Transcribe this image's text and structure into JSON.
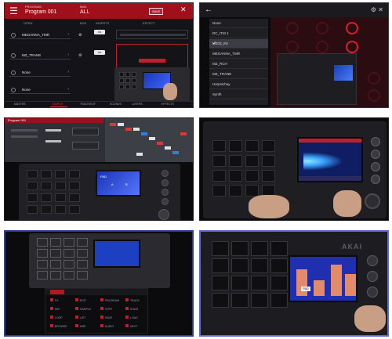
{
  "panel1": {
    "header_small": "PROGRAM",
    "program_name": "Program 001",
    "header_small2": "MIDI",
    "header_value": "ALL",
    "save_label": "SAVE",
    "close_icon": "close-icon",
    "back_icon": "back-arrow-icon",
    "columns": [
      "OPEN",
      "BUS",
      "INSERTS",
      "EFFECT"
    ],
    "rows": [
      {
        "label": "MEGANNA_TMR"
      },
      {
        "label": "MZ_TRANE"
      },
      {
        "label": "None"
      },
      {
        "label": "None"
      }
    ],
    "toggles": [
      "ON",
      "ON"
    ],
    "tabs": [
      "MASTER",
      "SAMPLE",
      "TRACKEDIT",
      "SOUNDS",
      "LAYERS",
      "EFFECTS"
    ],
    "active_tab_index": 1,
    "accent": "#a0101a"
  },
  "panel2": {
    "items": [
      {
        "label": "None",
        "selected": false
      },
      {
        "label": "RC_ITM 1",
        "selected": false
      },
      {
        "label": "MZ03_INI",
        "selected": true
      },
      {
        "label": "MEGANNA_TMR",
        "selected": false
      },
      {
        "label": "MZ_RCH",
        "selected": false
      },
      {
        "label": "MZ_TRANE",
        "selected": false
      },
      {
        "label": "Harpsichay",
        "selected": false
      },
      {
        "label": "Synth",
        "selected": false
      }
    ],
    "check_glyph": "✓"
  },
  "panel3": {
    "bar_title": "Program 001",
    "screen_labels": [
      "PAD",
      "A",
      "B"
    ]
  },
  "panel5": {
    "menu_items": [
      [
        "FX",
        "EDIT",
        "PROGRAM",
        "TRACK"
      ],
      [
        "MIX",
        "SAMPLE",
        "STEP",
        "SONG"
      ],
      [
        "LOOP",
        "LIST",
        "SAVE",
        "LOAD"
      ],
      [
        "BROWSE",
        "MIDI",
        "AUDIO",
        "NEXT"
      ]
    ]
  },
  "panel6": {
    "logo": "AKAI",
    "screen_label": "PAD"
  }
}
